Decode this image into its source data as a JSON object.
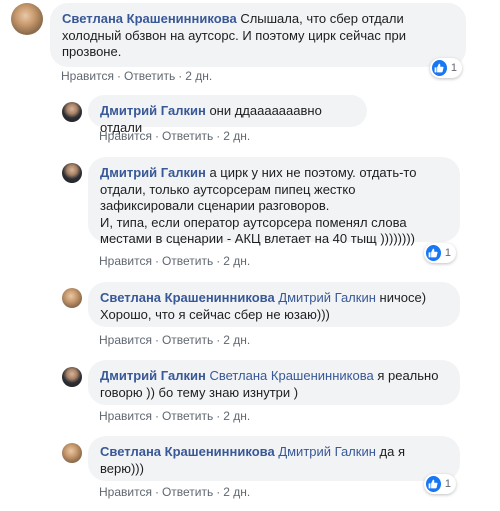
{
  "comments": [
    {
      "author": "Светлана Крашенинникова",
      "mention": "",
      "text": "Слышала, что сбер отдали холодный обзвон на аутсорс. И поэтому цирк сейчас при прозвоне.",
      "like": "Нравится",
      "reply": "Ответить",
      "time": "2 дн.",
      "reactions": "1"
    },
    {
      "author": "Дмитрий Галкин",
      "mention": "",
      "text": "они ддааааааавно отдали",
      "like": "Нравится",
      "reply": "Ответить",
      "time": "2 дн."
    },
    {
      "author": "Дмитрий Галкин",
      "mention": "",
      "text": "а цирк у них не поэтому. отдать-то отдали, только аутсорсерам пипец жестко зафиксировали сценарии разговоров.",
      "text2": "И, типа, если оператор аутсорсера поменял слова местами в сценарии - АКЦ влетает на 40 тыщ ))))))))",
      "like": "Нравится",
      "reply": "Ответить",
      "time": "2 дн.",
      "reactions": "1"
    },
    {
      "author": "Светлана Крашенинникова",
      "mention": "Дмитрий Галкин",
      "text": "ничосе) Хорошо, что я сейчас сбер не юзаю)))",
      "like": "Нравится",
      "reply": "Ответить",
      "time": "2 дн."
    },
    {
      "author": "Дмитрий Галкин",
      "mention": "Светлана Крашенинникова",
      "text": "я реально говорю )) бо тему знаю изнутри )",
      "like": "Нравится",
      "reply": "Ответить",
      "time": "2 дн."
    },
    {
      "author": "Светлана Крашенинникова",
      "mention": "Дмитрий Галкин",
      "text": "да я верю)))",
      "like": "Нравится",
      "reply": "Ответить",
      "time": "2 дн.",
      "reactions": "1"
    }
  ],
  "icons": {
    "like": "thumbs-up-icon"
  },
  "colors": {
    "author": "#385898",
    "bubble": "#f2f3f5",
    "like_badge": "#1877f2",
    "meta": "#606770"
  }
}
